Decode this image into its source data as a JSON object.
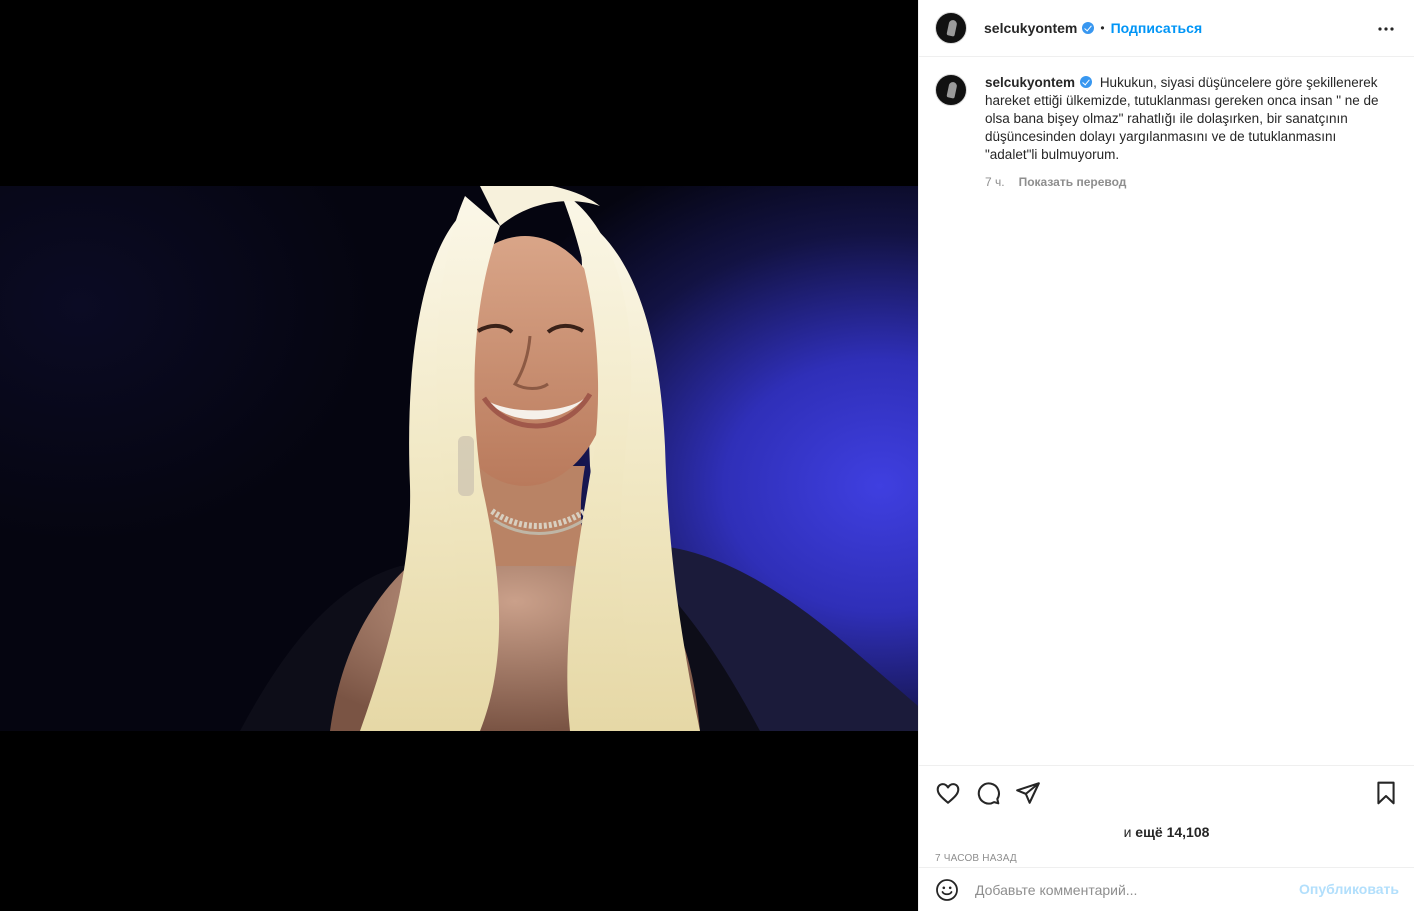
{
  "post": {
    "username": "selcukyontem",
    "verified": true,
    "follow_label": "Подписаться",
    "separator": "•",
    "more_icon": "more-horizontal-icon"
  },
  "caption": {
    "username": "selcukyontem",
    "text": "Hukukun, siyasi düşüncelere göre şekillenerek hareket ettiği ülkemizde, tutuklanması gereken onca insan \" ne de olsa bana bişey olmaz\" rahatlığı ile dolaşırken, bir sanatçının düşüncesinden dolayı yargılanmasını ve de tutuklanmasını \"adalet\"li bulmuyorum.",
    "time": "7 ч.",
    "translate_label": "Показать перевод"
  },
  "actions": {
    "icons": [
      "heart-icon",
      "comment-icon",
      "share-icon",
      "bookmark-icon"
    ]
  },
  "likes": {
    "prefix": "и",
    "count_label": "ещё 14,108"
  },
  "posted_ago": "7 часов назад",
  "comment": {
    "placeholder": "Добавьте комментарий...",
    "publish_label": "Опубликовать"
  },
  "colors": {
    "accent": "#0095f6",
    "publish_disabled": "#b2dffc",
    "verified": "#3897f0"
  }
}
